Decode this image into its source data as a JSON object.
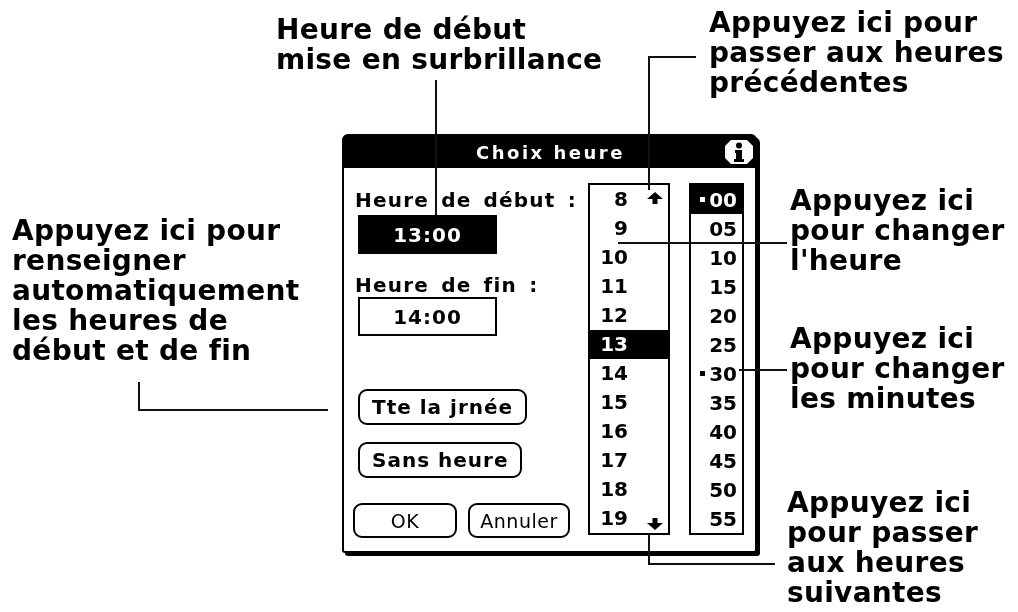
{
  "dialog": {
    "title": "Choix heure",
    "start_label": "Heure de début :",
    "start_time": {
      "value": "13:00",
      "selected": true
    },
    "end_label": "Heure de fin :",
    "end_time": {
      "value": "14:00",
      "selected": false
    },
    "buttons": [
      {
        "label": "Tte la jrnée"
      },
      {
        "label": "Sans heure"
      }
    ],
    "footer_buttons": [
      {
        "label": "OK"
      },
      {
        "label": "Annuler"
      }
    ],
    "hours": [
      {
        "label": "8",
        "selected": false
      },
      {
        "label": "9",
        "selected": false
      },
      {
        "label": "10",
        "selected": false
      },
      {
        "label": "11",
        "selected": false
      },
      {
        "label": "12",
        "selected": false
      },
      {
        "label": "13",
        "selected": true
      },
      {
        "label": "14",
        "selected": false
      },
      {
        "label": "15",
        "selected": false
      },
      {
        "label": "16",
        "selected": false
      },
      {
        "label": "17",
        "selected": false
      },
      {
        "label": "18",
        "selected": false
      },
      {
        "label": "19",
        "selected": false
      }
    ],
    "minutes": [
      {
        "label": "00",
        "selected": true,
        "marked": true
      },
      {
        "label": "05",
        "selected": false,
        "marked": false
      },
      {
        "label": "10",
        "selected": false,
        "marked": false
      },
      {
        "label": "15",
        "selected": false,
        "marked": false
      },
      {
        "label": "20",
        "selected": false,
        "marked": false
      },
      {
        "label": "25",
        "selected": false,
        "marked": false
      },
      {
        "label": "30",
        "selected": false,
        "marked": true
      },
      {
        "label": "35",
        "selected": false,
        "marked": false
      },
      {
        "label": "40",
        "selected": false,
        "marked": false
      },
      {
        "label": "45",
        "selected": false,
        "marked": false
      },
      {
        "label": "50",
        "selected": false,
        "marked": false
      },
      {
        "label": "55",
        "selected": false,
        "marked": false
      }
    ]
  },
  "callouts": [
    {
      "lines": [
        "Heure de début",
        "mise en surbrillance"
      ]
    },
    {
      "lines": [
        "Appuyez ici pour",
        "passer aux heures",
        "précédentes"
      ]
    },
    {
      "lines": [
        "Appuyez ici pour",
        "renseigner",
        "automatiquement",
        "les heures de",
        "début et de fin"
      ]
    },
    {
      "lines": [
        "Appuyez ici",
        "pour changer",
        "l'heure"
      ]
    },
    {
      "lines": [
        "Appuyez ici",
        "pour changer",
        "les minutes"
      ]
    },
    {
      "lines": [
        "Appuyez ici",
        "pour passer",
        "aux heures",
        "suivantes"
      ]
    }
  ]
}
